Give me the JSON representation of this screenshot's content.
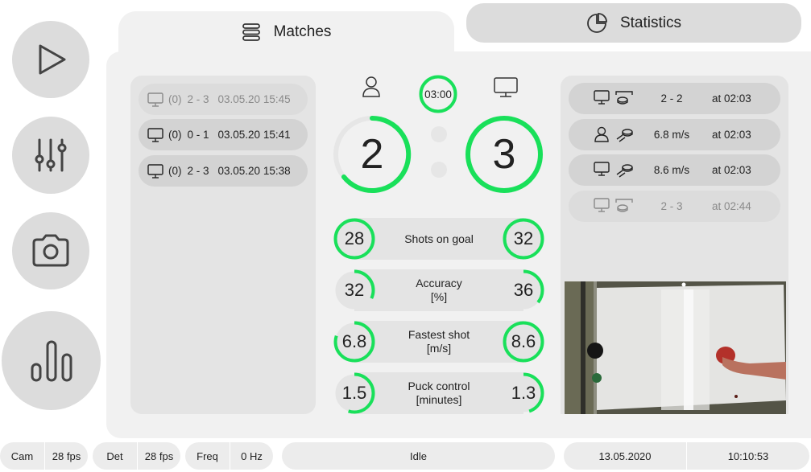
{
  "sidebar": {
    "items": [
      {
        "icon": "play-icon"
      },
      {
        "icon": "sliders-icon"
      },
      {
        "icon": "camera-icon"
      },
      {
        "icon": "bar-chart-icon"
      }
    ]
  },
  "tabs": {
    "matches": {
      "label": "Matches",
      "icon": "list-icon"
    },
    "statistics": {
      "label": "Statistics",
      "icon": "pie-chart-icon"
    }
  },
  "matches": [
    {
      "id": "(0)",
      "score": "2 - 3",
      "datetime": "03.05.20 15:45",
      "dimmed": true
    },
    {
      "id": "(0)",
      "score": "0 - 1",
      "datetime": "03.05.20 15:41",
      "dimmed": false
    },
    {
      "id": "(0)",
      "score": "2 - 3",
      "datetime": "03.05.20 15:38",
      "dimmed": false
    }
  ],
  "scoreboard": {
    "timer": "03:00",
    "player_score": "2",
    "computer_score": "3",
    "player_icon": "user-icon",
    "computer_icon": "monitor-icon"
  },
  "stats": [
    {
      "label_line1": "Shots on goal",
      "label_line2": "",
      "player": "28",
      "computer": "32",
      "player_fraction": 1.0,
      "computer_fraction": 1.0
    },
    {
      "label_line1": "Accuracy",
      "label_line2": "[%]",
      "player": "32",
      "computer": "36",
      "player_fraction": 0.32,
      "computer_fraction": 0.36
    },
    {
      "label_line1": "Fastest shot",
      "label_line2": "[m/s]",
      "player": "6.8",
      "computer": "8.6",
      "player_fraction": 0.8,
      "computer_fraction": 1.0
    },
    {
      "label_line1": "Puck control",
      "label_line2": "[minutes]",
      "player": "1.5",
      "computer": "1.3",
      "player_fraction": 0.55,
      "computer_fraction": 0.45
    }
  ],
  "events": [
    {
      "actor": "monitor-icon",
      "event": "goal-icon",
      "value": "2 - 2",
      "time": "at 02:03",
      "dimmed": false
    },
    {
      "actor": "user-icon",
      "event": "shot-icon",
      "value": "6.8 m/s",
      "time": "at 02:03",
      "dimmed": false
    },
    {
      "actor": "monitor-icon",
      "event": "shot-icon",
      "value": "8.6 m/s",
      "time": "at 02:03",
      "dimmed": false
    },
    {
      "actor": "monitor-icon",
      "event": "goal-icon",
      "value": "2 - 3",
      "time": "at 02:44",
      "dimmed": true
    }
  ],
  "status": {
    "cam_label": "Cam",
    "cam_value": "28 fps",
    "det_label": "Det",
    "det_value": "28 fps",
    "freq_label": "Freq",
    "freq_value": "0 Hz",
    "state": "Idle",
    "date": "13.05.2020",
    "time": "10:10:53"
  },
  "colors": {
    "accent": "#19e05a",
    "button": "#dcdcdc",
    "panel": "#f1f1f1"
  }
}
